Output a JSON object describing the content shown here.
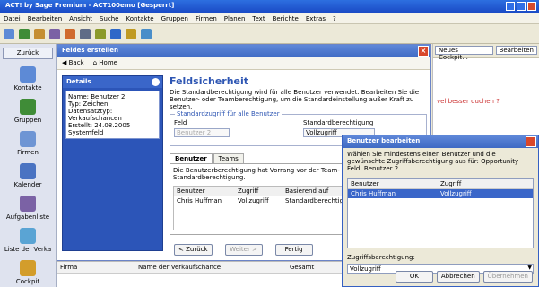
{
  "app": {
    "title": "ACT! by Sage Premium - ACT100emo [Gesperrt]"
  },
  "menu": [
    "Datei",
    "Bearbeiten",
    "Ansicht",
    "Suche",
    "Kontakte",
    "Gruppen",
    "Firmen",
    "Planen",
    "Text",
    "Berichte",
    "Extras",
    "?"
  ],
  "toolbar_icons": [
    {
      "name": "contacts-icon",
      "color": "#5d8ad6"
    },
    {
      "name": "group-icon",
      "color": "#3f8c37"
    },
    {
      "name": "write-icon",
      "color": "#c58e32"
    },
    {
      "name": "attach-icon",
      "color": "#7b62a5"
    },
    {
      "name": "calendar-icon",
      "color": "#d06a2d"
    },
    {
      "name": "list-icon",
      "color": "#5f6c87"
    },
    {
      "name": "mail-icon",
      "color": "#8b9a2a"
    },
    {
      "name": "help-icon",
      "color": "#2e68c8"
    },
    {
      "name": "favorites-icon",
      "color": "#c09a22"
    },
    {
      "name": "lookup-icon",
      "color": "#4a8ec9"
    }
  ],
  "nav": {
    "back": "Zurück",
    "items": [
      {
        "label": "Kontakte",
        "icon": "contacts-icon"
      },
      {
        "label": "Gruppen",
        "icon": "groups-icon"
      },
      {
        "label": "Firmen",
        "icon": "companies-icon"
      },
      {
        "label": "Kalender",
        "icon": "calendar-icon"
      },
      {
        "label": "Aufgabenliste",
        "icon": "tasklist-icon"
      },
      {
        "label": "Liste der Verka",
        "icon": "sales-icon"
      },
      {
        "label": "Cockpit",
        "icon": "cockpit-icon"
      }
    ]
  },
  "wizard": {
    "title": "Feldes erstellen",
    "back": "Back",
    "home": "Home",
    "details_title": "Details",
    "details_text": "Name: Benutzer 2\nTyp: Zeichen\nDatensatztyp: Verkaufschancen\nErstellt: 24.08.2005\nSystemfeld",
    "heading": "Feldsicherheit",
    "description": "Die Standardberechtigung wird für alle Benutzer verwendet. Bearbeiten Sie die Benutzer- oder Teamberechtigung, um die Standardeinstellung außer Kraft zu setzen.",
    "fieldset_title": "Standardzugriff für alle Benutzer",
    "field_label": "Feld",
    "field_value": "Benutzer 2",
    "std_label": "Standardberechtigung",
    "std_value": "Vollzugriff",
    "tab_users": "Benutzer",
    "tab_teams": "Teams",
    "tab_note": "Die Benutzerberechtigung hat Vorrang vor der Team- und der Standardberechtigung.",
    "columns": [
      "Benutzer",
      "Zugriff",
      "Basierend auf"
    ],
    "rows": [
      [
        "Chris Huffman",
        "Vollzugriff",
        "Standardberechtigung"
      ]
    ],
    "btn_back": "< Zurück",
    "btn_next": "Weiter >",
    "btn_finish": "Fertig"
  },
  "right": {
    "button_cockpit": "Neues Cockpit...",
    "button_edit": "Bearbeiten",
    "link_text": "vel besser duchen ?"
  },
  "bottom": {
    "columns": [
      "Firma",
      "Name der Verkaufschance",
      "Gesamt"
    ]
  },
  "dialog": {
    "title": "Benutzer bearbeiten",
    "instructions": "Wählen Sie mindestens einen Benutzer und die gewünschte Zugriffsberechtigung aus für: Opportunity Feld: Benutzer 2",
    "columns": [
      "Benutzer",
      "Zugriff"
    ],
    "rows": [
      [
        "Chris Huffman",
        "Vollzugriff"
      ]
    ],
    "access_label": "Zugriffsberechtigung:",
    "access_value": "Vollzugriff",
    "ok": "OK",
    "cancel": "Abbrechen",
    "help": "Übernehmen"
  }
}
